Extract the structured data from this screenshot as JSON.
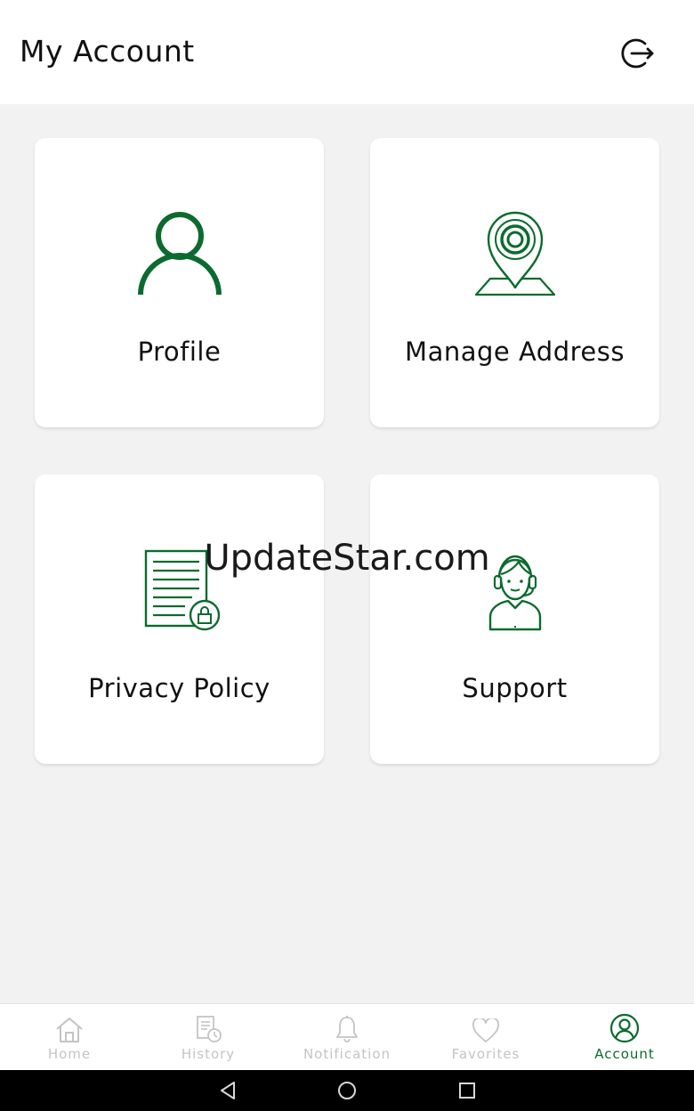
{
  "header": {
    "title": "My Account",
    "logout_icon": "logout-icon"
  },
  "colors": {
    "accent": "#0b6b2e",
    "inactive": "#c4c4c4",
    "background": "#f2f2f2",
    "card": "#ffffff"
  },
  "cards": [
    {
      "label": "Profile",
      "icon": "person-icon"
    },
    {
      "label": "Manage Address",
      "icon": "location-pin-icon"
    },
    {
      "label": "Privacy Policy",
      "icon": "document-lock-icon"
    },
    {
      "label": "Support",
      "icon": "support-agent-icon"
    }
  ],
  "watermark": "UpdateStar.com",
  "bottom_nav": {
    "active": "Account",
    "items": [
      {
        "label": "Home",
        "icon": "home-icon"
      },
      {
        "label": "History",
        "icon": "history-icon"
      },
      {
        "label": "Notification",
        "icon": "bell-icon"
      },
      {
        "label": "Favorites",
        "icon": "heart-icon"
      },
      {
        "label": "Account",
        "icon": "account-icon"
      }
    ]
  },
  "system_bar": {
    "buttons": [
      "back-icon",
      "home-circle-icon",
      "recents-icon"
    ]
  }
}
